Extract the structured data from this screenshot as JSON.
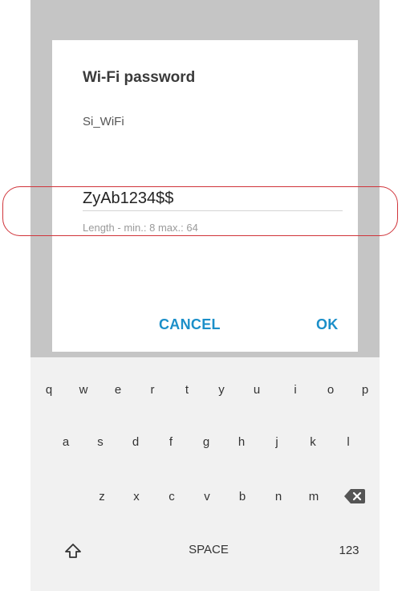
{
  "dialog": {
    "title": "Wi-Fi password",
    "ssid": "Si_WiFi",
    "password_value": "ZyAb1234$$",
    "hint": "Length - min.: 8 max.: 64",
    "cancel_label": "CANCEL",
    "ok_label": "OK"
  },
  "keyboard": {
    "row1": [
      "q",
      "w",
      "e",
      "r",
      "t",
      "y",
      "u",
      "i",
      "o",
      "p"
    ],
    "row2": [
      "a",
      "s",
      "d",
      "f",
      "g",
      "h",
      "j",
      "k",
      "l"
    ],
    "row3": [
      "z",
      "x",
      "c",
      "v",
      "b",
      "n",
      "m"
    ],
    "shift_icon": "shift-arrow-icon",
    "backspace_icon": "backspace-icon",
    "space_label": "SPACE",
    "numbers_label": "123"
  },
  "colors": {
    "accent": "#1b8fc9",
    "highlight_outline": "#d0343a",
    "overlay": "#c5c5c5",
    "keyboard_bg": "#f1f1f1"
  }
}
